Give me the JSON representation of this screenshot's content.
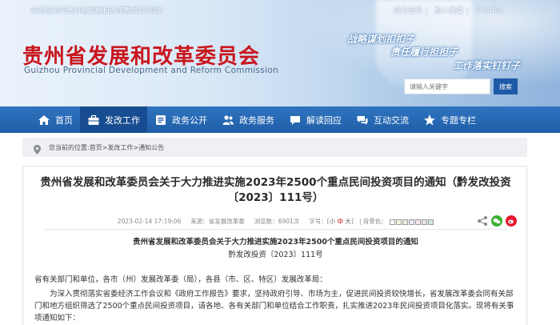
{
  "topbar": {
    "welcome": "欢迎您访问贵州省发展和改革委员会网站！",
    "links": [
      "设为首页",
      "加入收藏",
      "个人中心"
    ]
  },
  "logo": {
    "cn": "贵州省发展和改革委员会",
    "en": "Guizhou Provincial Development and Reform Commission"
  },
  "slogans": [
    "战略谋划扣扣子",
    "责任履行担担子",
    "工作落实钉钉子"
  ],
  "search": {
    "placeholder": "请输入关键字",
    "button": "搜索"
  },
  "nav": {
    "items": [
      {
        "label": "首页",
        "icon": "home-icon"
      },
      {
        "label": "发改工作",
        "icon": "briefcase-icon"
      },
      {
        "label": "政务公开",
        "icon": "open-gov-icon"
      },
      {
        "label": "政务服务",
        "icon": "people-icon"
      },
      {
        "label": "解读回应",
        "icon": "chat-icon"
      },
      {
        "label": "互动交流",
        "icon": "message-icon"
      },
      {
        "label": "专题专栏",
        "icon": "star-icon"
      }
    ],
    "active_index": 1
  },
  "breadcrumb": {
    "prefix": "您当前的位置:",
    "items": [
      "首页",
      "发改工作",
      "通知公告"
    ],
    "separator": " > "
  },
  "article": {
    "title": "贵州省发展和改革委员会关于大力推进实施2023年2500个重点民间投资项目的通知（黔发改投资〔2023〕111号）",
    "meta": {
      "date": "2023-02-14 17:19:06",
      "source_label": "来源：",
      "source": "省发展改革委",
      "views_label": "浏览数：",
      "views": "6901次",
      "font_prefix": "字号：",
      "font_small": "小",
      "font_mid": "中",
      "font_large": "大",
      "theme_label": "| 背景色："
    },
    "theme_swatches": [
      "#ffffff",
      "#f7f0dc",
      "#e5f1d9",
      "#e9eaf7",
      "#f2e6ea",
      "#e6e6e6",
      "#d8ead9"
    ],
    "share_icons": [
      "share-icon",
      "wechat-icon",
      "weibo-icon"
    ],
    "doc_title": "贵州省发展和改革委员会关于大力推进实施2023年2500个重点民间投资项目的通知",
    "doc_no": "黔发改投资〔2023〕111号",
    "recipients": "省有关部门和单位，各市（州）发展改革委（局），各县（市、区、特区）发展改革局：",
    "paragraph1": "为深入贯彻落实省委经济工作会议和《政府工作报告》要求，坚持政府引导、市场为主，促进民间投资较快增长，省发展改革委会同有关部门和地方组织筛选了2500个重点民间投资项目，请各地、各有关部门和单位结合工作职责，扎实推进2023年民间投资项目化落实。现将有关事项通知如下："
  },
  "colors": {
    "brand_red": "#c8161d",
    "nav_blue": "#1f5ea8",
    "nav_active": "#174d90"
  }
}
